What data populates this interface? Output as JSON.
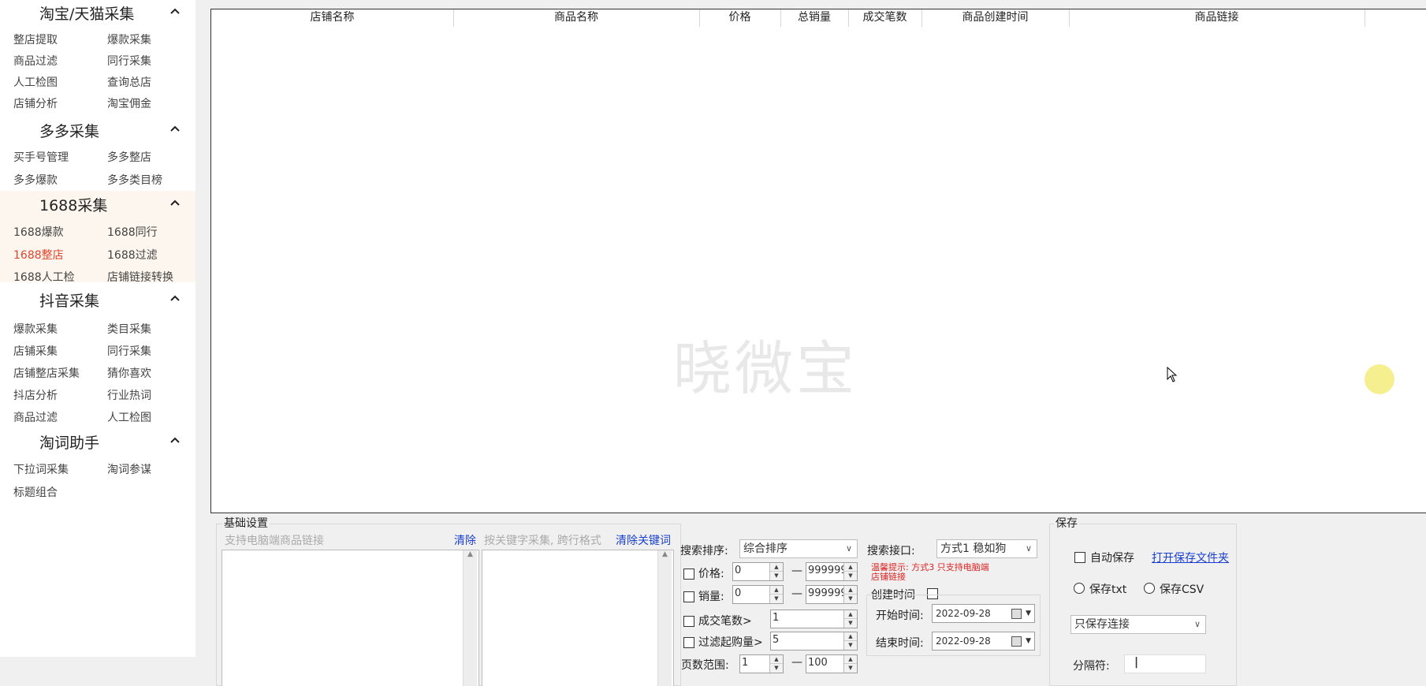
{
  "sidebar": {
    "sections": [
      {
        "title": "淘宝/天猫采集",
        "items": [
          "整店提取",
          "爆款采集",
          "商品过滤",
          "同行采集",
          "人工检图",
          "查询总店",
          "店铺分析",
          "淘宝佣金"
        ]
      },
      {
        "title": "多多采集",
        "items": [
          "买手号管理",
          "多多整店",
          "多多爆款",
          "多多类目榜"
        ]
      },
      {
        "title": "1688采集",
        "items": [
          "1688爆款",
          "1688同行",
          "1688整店",
          "1688过滤",
          "1688人工检",
          "店铺链接转换"
        ],
        "active_item": "1688整店"
      },
      {
        "title": "抖音采集",
        "items": [
          "爆款采集",
          "类目采集",
          "店铺采集",
          "同行采集",
          "店铺整店采集",
          "猜你喜欢",
          "抖店分析",
          "行业热词",
          "商品过滤",
          "人工检图"
        ]
      },
      {
        "title": "淘词助手",
        "items": [
          "下拉词采集",
          "淘词参谋",
          "标题组合"
        ]
      }
    ]
  },
  "table": {
    "columns": [
      "店铺名称",
      "商品名称",
      "价格",
      "总销量",
      "成交笔数",
      "商品创建时间",
      "商品链接"
    ],
    "watermark": "晓微宝"
  },
  "basic": {
    "title": "基础设置",
    "link_placeholder": "支持电脑端商品链接",
    "clear": "清除",
    "keyword_placeholder": "按关键字采集, 跨行格式",
    "clear_keywords": "清除关键词"
  },
  "search": {
    "sort_label": "搜索排序:",
    "sort_value": "综合排序",
    "api_label": "搜索接口:",
    "api_value": "方式1 稳如狗",
    "tip_line1": "温馨提示: 方式3 只支持电脑端",
    "tip_line2": "店铺链接",
    "price_label": "价格:",
    "price_min": "0",
    "price_max": "999999",
    "sales_label": "销量:",
    "sales_min": "0",
    "sales_max": "999999",
    "deals_label": "成交笔数>",
    "deals_value": "1",
    "moq_label": "过滤起购量>",
    "moq_value": "5",
    "pages_label": "页数范围:",
    "page_min": "1",
    "page_max": "100",
    "dash": "—",
    "created_label": "创建时间",
    "start_label": "开始时间:",
    "start_date": "2022-09-28",
    "end_label": "结束时间:",
    "end_date": "2022-09-28"
  },
  "save": {
    "title": "保存",
    "auto_save": "自动保存",
    "open_folder": "打开保存文件夹",
    "txt": "保存txt",
    "csv": "保存CSV",
    "mode": "只保存连接",
    "sep_label": "分隔符:",
    "sep_value": "|"
  },
  "colors": {
    "active": "#e0442d",
    "link": "#1a3fcf",
    "warning": "#dd2222",
    "highlight": "#f3ec7c"
  }
}
